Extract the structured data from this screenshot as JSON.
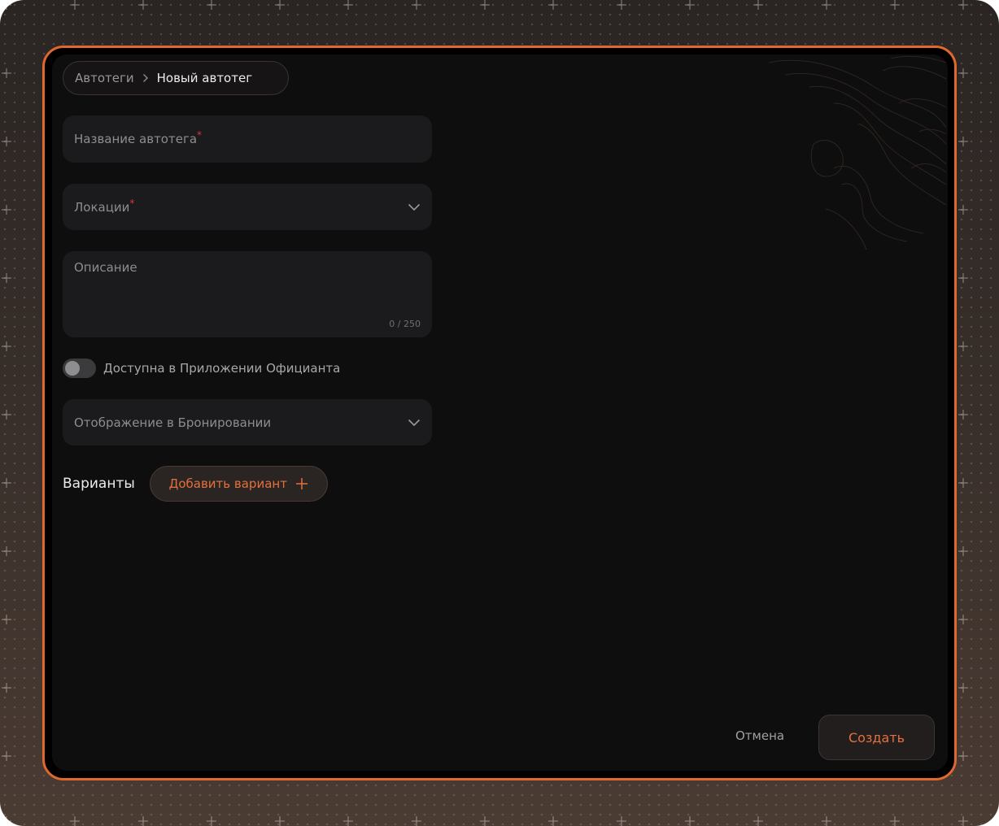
{
  "breadcrumb": {
    "parent": "Автотеги",
    "separator_icon": "chevron-right-icon",
    "current": "Новый автотег"
  },
  "form": {
    "name_field": {
      "label": "Название автотега",
      "required_mark": "*",
      "value": ""
    },
    "locations_field": {
      "label": "Локации",
      "required_mark": "*",
      "value": "",
      "icon": "chevron-down-icon"
    },
    "description_field": {
      "label": "Описание",
      "value": "",
      "counter": "0 / 250"
    },
    "waiter_app_toggle": {
      "label": "Доступна в Приложении Официанта",
      "on": false
    },
    "booking_display_field": {
      "label": "Отображение в Бронировании",
      "value": "",
      "icon": "chevron-down-icon"
    }
  },
  "variants": {
    "title": "Варианты",
    "add_button_label": "Добавить вариант",
    "add_icon": "plus-icon"
  },
  "actions": {
    "cancel_label": "Отмена",
    "create_label": "Создать"
  },
  "colors": {
    "accent": "#e0682e",
    "panel_bg": "#0e0e0e",
    "field_bg": "#1b1b1d",
    "required": "#e0304a"
  }
}
